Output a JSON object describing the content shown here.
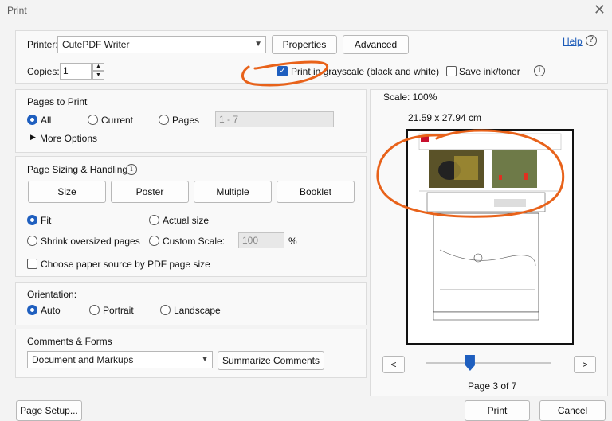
{
  "window": {
    "title": "Print"
  },
  "printer": {
    "label": "Printer:",
    "value": "CutePDF Writer",
    "properties_label": "Properties",
    "advanced_label": "Advanced",
    "help_label": "Help"
  },
  "copies": {
    "label": "Copies:",
    "value": "1"
  },
  "options": {
    "grayscale_label": "Print in grayscale (black and white)",
    "grayscale_checked": true,
    "save_ink_label": "Save ink/toner",
    "save_ink_checked": false
  },
  "pages_to_print": {
    "heading": "Pages to Print",
    "all_label": "All",
    "current_label": "Current",
    "pages_label": "Pages",
    "pages_placeholder": "1 - 7",
    "more_options_label": "More Options"
  },
  "sizing": {
    "heading": "Page Sizing & Handling",
    "buttons": [
      "Size",
      "Poster",
      "Multiple",
      "Booklet"
    ],
    "fit_label": "Fit",
    "actual_label": "Actual size",
    "shrink_label": "Shrink oversized pages",
    "custom_label": "Custom Scale:",
    "custom_value": "100",
    "percent": "%",
    "paper_source_label": "Choose paper source by PDF page size"
  },
  "orientation": {
    "heading": "Orientation:",
    "auto_label": "Auto",
    "portrait_label": "Portrait",
    "landscape_label": "Landscape"
  },
  "comments": {
    "heading": "Comments & Forms",
    "value": "Document and Markups",
    "summarize_label": "Summarize Comments"
  },
  "preview": {
    "scale": "Scale: 100%",
    "dimensions": "21.59 x 27.94 cm",
    "page_indicator": "Page 3 of 7",
    "prev": "<",
    "next": ">",
    "slider_fraction": 0.35
  },
  "footer": {
    "page_setup_label": "Page Setup...",
    "print_label": "Print",
    "cancel_label": "Cancel"
  },
  "colors": {
    "accent": "#1f5fbf",
    "annotation": "#e8621a"
  }
}
